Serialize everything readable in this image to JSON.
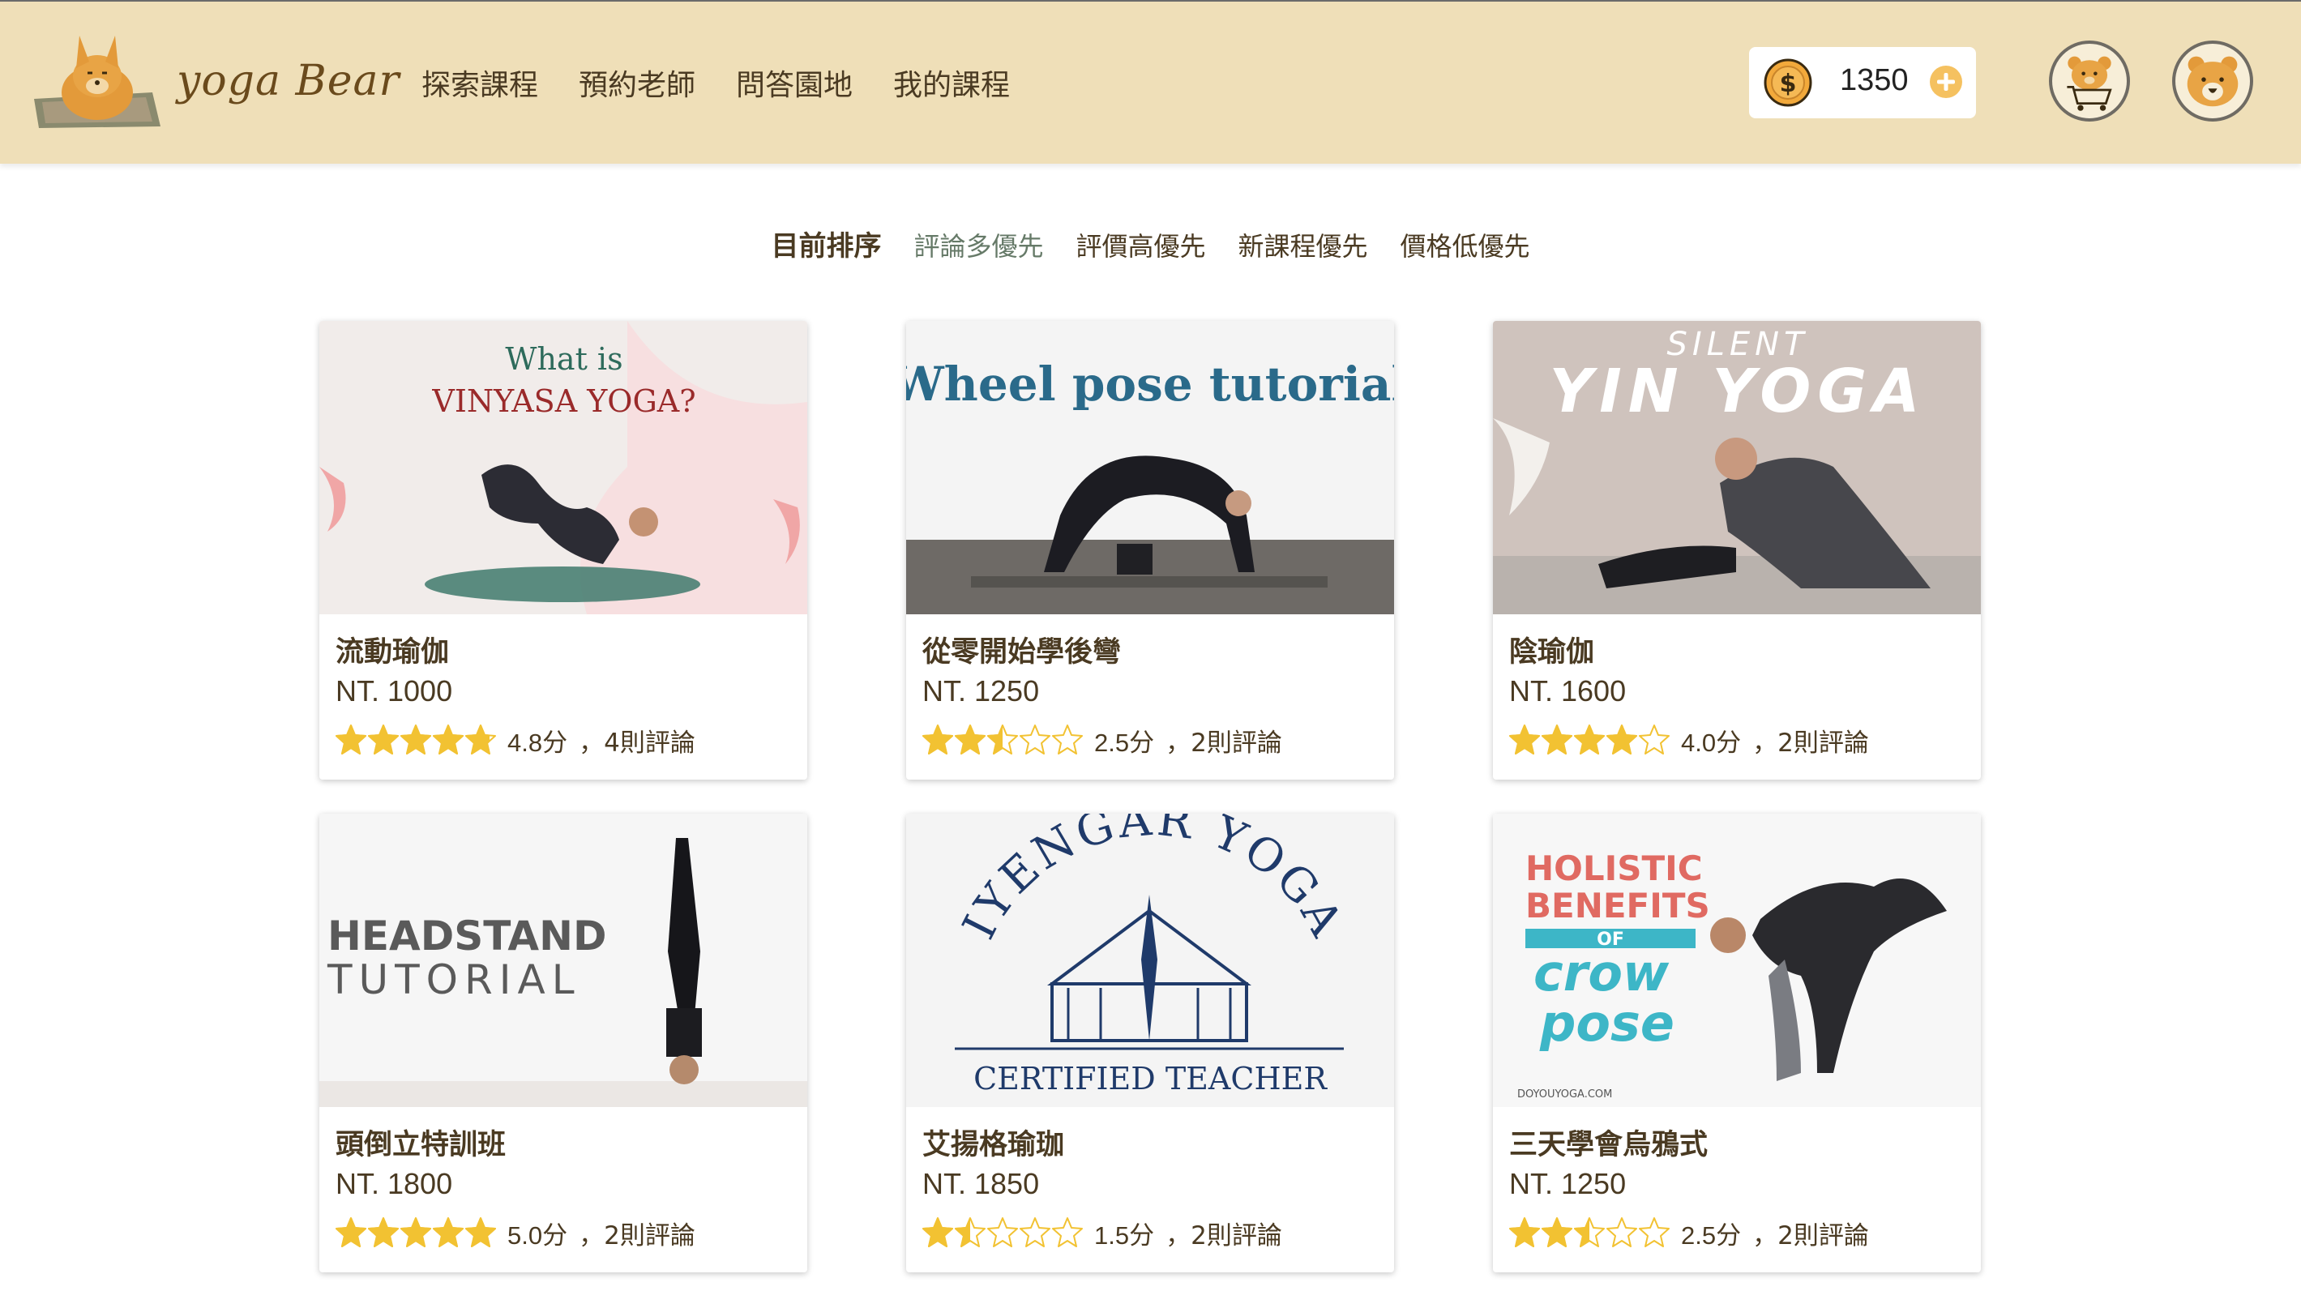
{
  "brand": {
    "name": "Yoga Bear",
    "logo_text": "yoga Bear"
  },
  "nav": [
    "探索課程",
    "預約老師",
    "問答園地",
    "我的課程"
  ],
  "wallet": {
    "balance": "1350",
    "coin_icon": "dollar-coin-icon",
    "add_icon": "plus-circle-icon"
  },
  "header_icons": {
    "cart": "bear-cart-avatar",
    "user": "bear-user-avatar"
  },
  "sort": {
    "label": "目前排序",
    "options": [
      "評論多優先",
      "評價高優先",
      "新課程優先",
      "價格低優先"
    ],
    "active_index": 0
  },
  "colors": {
    "header_bg": "#efdfb8",
    "text": "#4a3a22",
    "active_sort": "#667a68",
    "star": "#f2c232",
    "coin": "#f2a93b"
  },
  "courses": [
    {
      "thumb_lines": [
        "What is",
        "VINYASA YOGA?"
      ],
      "title": "流動瑜伽",
      "price": "NT. 1000",
      "rating": 4.8,
      "rating_text": "4.8分",
      "reviews": "，4則評論"
    },
    {
      "thumb_lines": [
        "Wheel pose tutorial"
      ],
      "title": "從零開始學後彎",
      "price": "NT. 1250",
      "rating": 2.5,
      "rating_text": "2.5分",
      "reviews": "，2則評論"
    },
    {
      "thumb_lines": [
        "SILENT",
        "YIN YOGA"
      ],
      "title": "陰瑜伽",
      "price": "NT. 1600",
      "rating": 4.0,
      "rating_text": "4.0分",
      "reviews": "，2則評論"
    },
    {
      "thumb_lines": [
        "HEADSTAND",
        "TUTORIAL"
      ],
      "title": "頭倒立特訓班",
      "price": "NT. 1800",
      "rating": 5.0,
      "rating_text": "5.0分",
      "reviews": "，2則評論"
    },
    {
      "thumb_lines": [
        "IYENGAR YOGA",
        "CERTIFIED TEACHER"
      ],
      "title": "艾揚格瑜珈",
      "price": "NT. 1850",
      "rating": 1.5,
      "rating_text": "1.5分",
      "reviews": "，2則評論"
    },
    {
      "thumb_lines": [
        "HOLISTIC",
        "BENEFITS",
        "OF",
        "crow",
        "pose",
        "DOYOUYOGA.COM"
      ],
      "title": "三天學會烏鴉式",
      "price": "NT. 1250",
      "rating": 2.5,
      "rating_text": "2.5分",
      "reviews": "，2則評論"
    }
  ]
}
